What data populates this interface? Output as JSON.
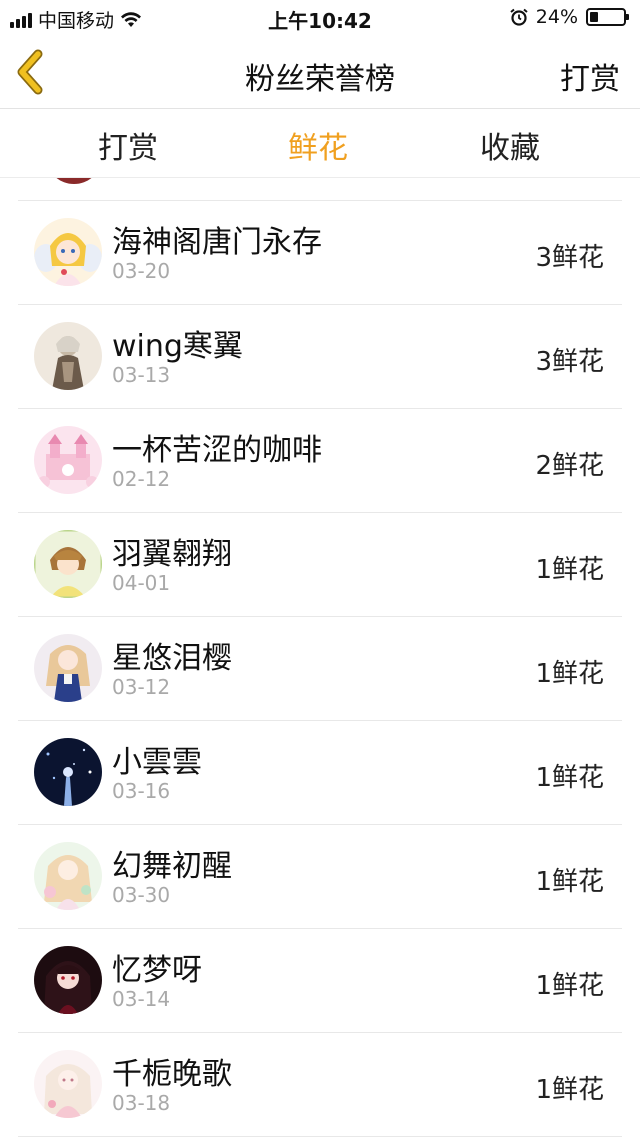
{
  "status_bar": {
    "carrier": "中国移动",
    "time": "上午10:42",
    "battery_pct": "24%",
    "battery_level": 0.24
  },
  "nav": {
    "title": "粉丝荣誉榜",
    "right_action": "打赏",
    "back_icon": "chevron-left-icon",
    "back_color": "#f0a020"
  },
  "tabs": [
    {
      "label": "打赏",
      "active": false
    },
    {
      "label": "鲜花",
      "active": true
    },
    {
      "label": "收藏",
      "active": false
    }
  ],
  "accent_color": "#f0a020",
  "entries": [
    {
      "name": "海神阁唐门永存",
      "date": "03-20",
      "count": "3鲜花",
      "avatar": "angel-girl-avatar"
    },
    {
      "name": "wing寒翼",
      "date": "03-13",
      "count": "3鲜花",
      "avatar": "sepia-character-avatar"
    },
    {
      "name": "一杯苦涩的咖啡",
      "date": "02-12",
      "count": "2鲜花",
      "avatar": "pink-castle-avatar"
    },
    {
      "name": "羽翼翱翔",
      "date": "04-01",
      "count": "1鲜花",
      "avatar": "brown-hair-boy-avatar"
    },
    {
      "name": "星悠泪樱",
      "date": "03-12",
      "count": "1鲜花",
      "avatar": "blue-dress-girl-avatar"
    },
    {
      "name": "小雲雲",
      "date": "03-16",
      "count": "1鲜花",
      "avatar": "night-sky-avatar"
    },
    {
      "name": "幻舞初醒",
      "date": "03-30",
      "count": "1鲜花",
      "avatar": "pastel-flower-girl-avatar"
    },
    {
      "name": "忆梦呀",
      "date": "03-14",
      "count": "1鲜花",
      "avatar": "dark-hair-girl-avatar"
    },
    {
      "name": "千栀晚歌",
      "date": "03-18",
      "count": "1鲜花",
      "avatar": "pink-hair-girl-avatar"
    }
  ]
}
